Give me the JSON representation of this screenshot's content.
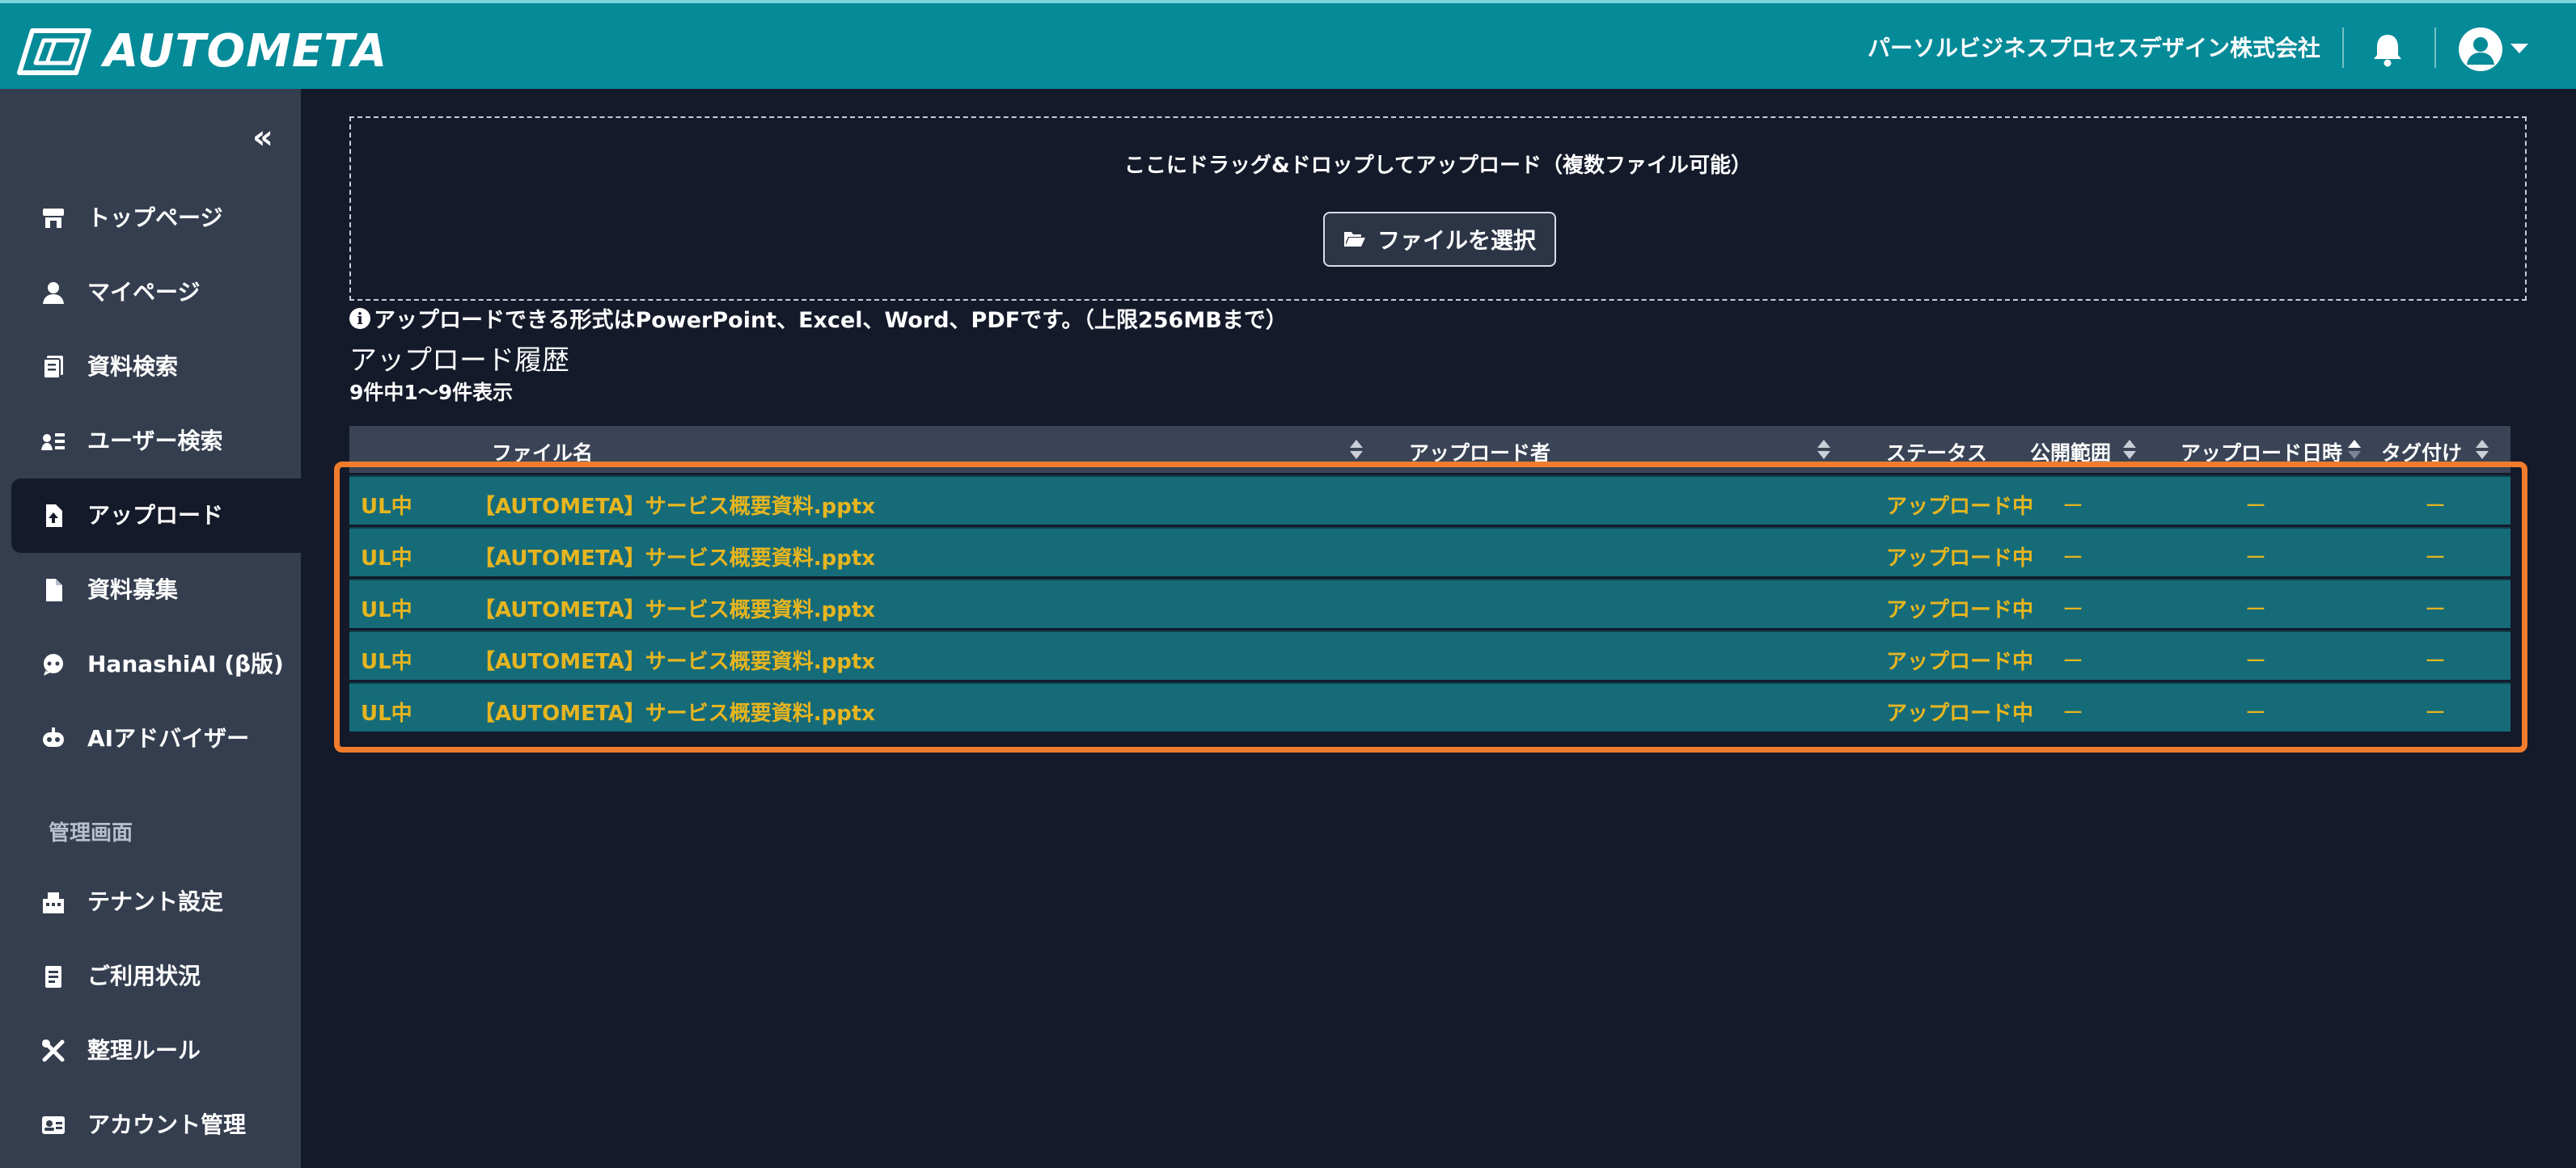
{
  "header": {
    "app_name": "AUTOMETA",
    "company": "パーソルビジネスプロセスデザイン株式会社",
    "bell_icon": "bell-icon",
    "avatar_icon": "user-avatar-icon",
    "accent_color": "#058a98"
  },
  "sidebar": {
    "collapse_label": "«",
    "items": [
      {
        "label": "トップページ",
        "icon": "store-icon"
      },
      {
        "label": "マイページ",
        "icon": "user-icon"
      },
      {
        "label": "資料検索",
        "icon": "document-search-icon"
      },
      {
        "label": "ユーザー検索",
        "icon": "user-list-icon"
      },
      {
        "label": "アップロード",
        "icon": "file-upload-icon"
      },
      {
        "label": "資料募集",
        "icon": "file-icon"
      },
      {
        "label": "HanashiAI (β版)",
        "icon": "chat-bot-icon"
      },
      {
        "label": "AIアドバイザー",
        "icon": "robot-icon"
      }
    ],
    "admin_section": "管理画面",
    "admin_items": [
      {
        "label": "テナント設定",
        "icon": "building-icon"
      },
      {
        "label": "ご利用状況",
        "icon": "clipboard-icon"
      },
      {
        "label": "整理ルール",
        "icon": "tools-icon"
      },
      {
        "label": "アカウント管理",
        "icon": "id-card-icon"
      }
    ],
    "active_item": "アップロード"
  },
  "upload": {
    "drop_text": "ここにドラッグ&ドロップしてアップロード（複数ファイル可能）",
    "select_button": "ファイルを選択",
    "note": "アップロードできる形式はPowerPoint、Excel、Word、PDFです。（上限256MBまで）"
  },
  "history": {
    "title": "アップロード履歴",
    "count": "9件中1～9件表示",
    "columns": [
      "ファイル名",
      "アップロード者",
      "ステータス",
      "公開範囲",
      "アップロード日時",
      "タグ付け"
    ],
    "rows": [
      {
        "badge": "UL中",
        "filename": "【AUTOMETA】サービス概要資料.pptx",
        "uploader": "",
        "status": "アップロード中",
        "scope": "ー",
        "datetime": "ー",
        "tag": "ー"
      },
      {
        "badge": "UL中",
        "filename": "【AUTOMETA】サービス概要資料.pptx",
        "uploader": "",
        "status": "アップロード中",
        "scope": "ー",
        "datetime": "ー",
        "tag": "ー"
      },
      {
        "badge": "UL中",
        "filename": "【AUTOMETA】サービス概要資料.pptx",
        "uploader": "",
        "status": "アップロード中",
        "scope": "ー",
        "datetime": "ー",
        "tag": "ー"
      },
      {
        "badge": "UL中",
        "filename": "【AUTOMETA】サービス概要資料.pptx",
        "uploader": "",
        "status": "アップロード中",
        "scope": "ー",
        "datetime": "ー",
        "tag": "ー"
      },
      {
        "badge": "UL中",
        "filename": "【AUTOMETA】サービス概要資料.pptx",
        "uploader": "",
        "status": "アップロード中",
        "scope": "ー",
        "datetime": "ー",
        "tag": "ー"
      }
    ],
    "row_color": "#166b78",
    "status_color": "#e6b520",
    "highlight_color": "#f07c2c"
  }
}
